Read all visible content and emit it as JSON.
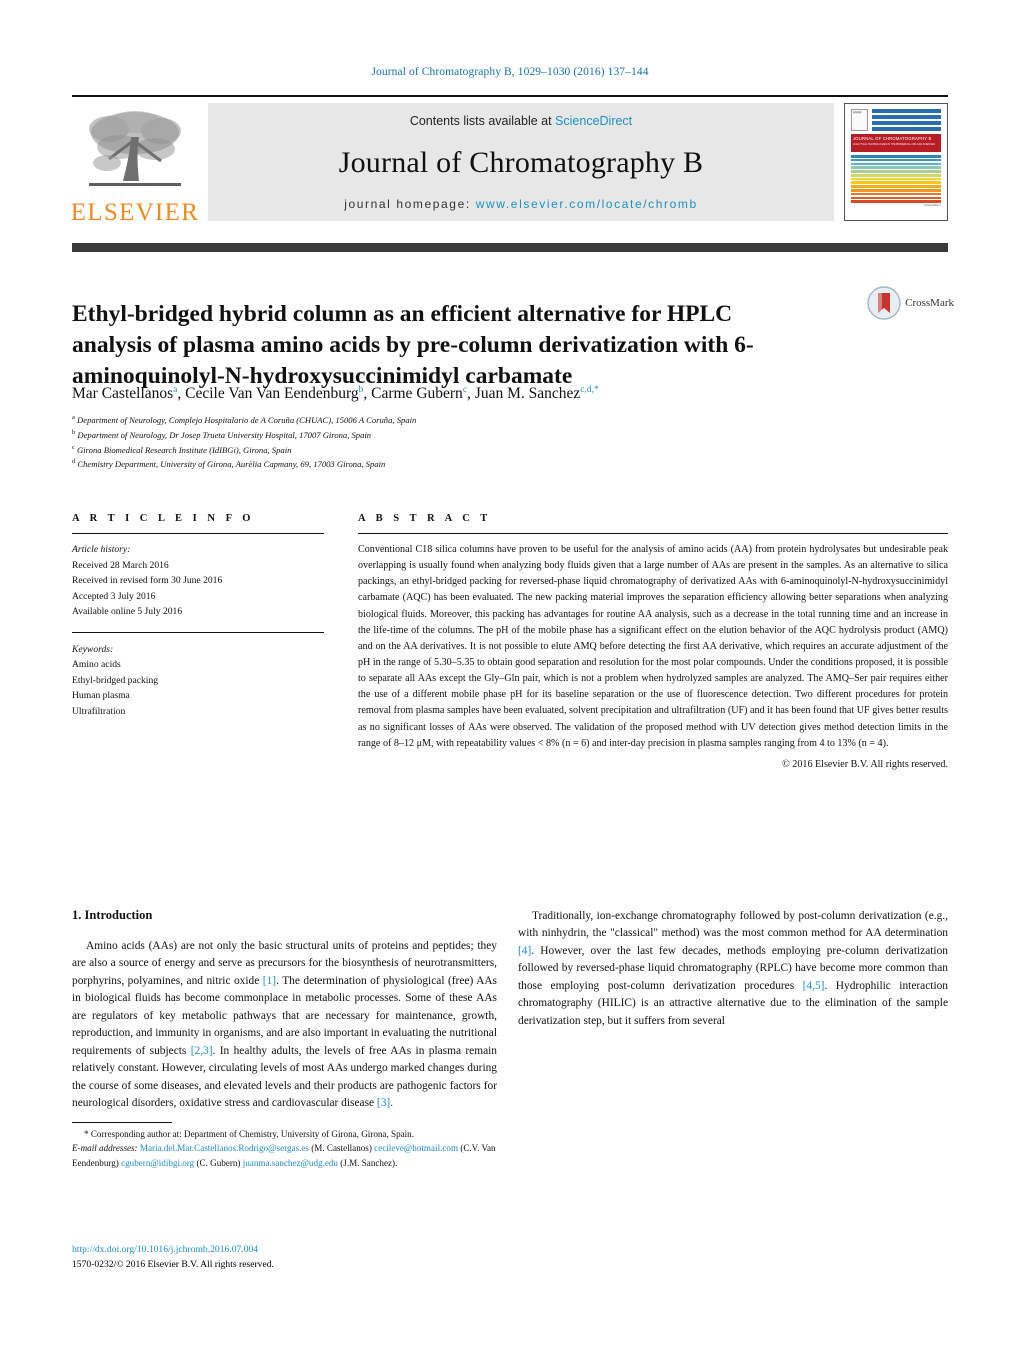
{
  "running_head": "Journal of Chromatography B, 1029–1030 (2016) 137–144",
  "masthead": {
    "contents_prefix": "Contents lists available at ",
    "contents_link": "ScienceDirect",
    "journal_title": "Journal of Chromatography B",
    "homepage_prefix": "journal homepage: ",
    "homepage_url": "www.elsevier.com/locate/chromb",
    "publisher": "ELSEVIER",
    "cover": {
      "banner_title": "JOURNAL OF CHROMATOGRAPHY B",
      "banner_subtitle": "ANALYTICAL TECHNOLOGIES IN THE BIOMEDICAL AND LIFE SCIENCES",
      "footer": "ScienceDirect"
    },
    "crossmark_label": "CrossMark"
  },
  "article": {
    "title": "Ethyl-bridged hybrid column as an efficient alternative for HPLC analysis of plasma amino acids by pre-column derivatization with 6-aminoquinolyl-N-hydroxysuccinimidyl carbamate",
    "authors": [
      {
        "name": "Mar Castellanos",
        "sup": "a"
      },
      {
        "name": "Cecile Van Van Eendenburg",
        "sup": "b"
      },
      {
        "name": "Carme Gubern",
        "sup": "c"
      },
      {
        "name": "Juan M. Sanchez",
        "sup": "c,d,*"
      }
    ],
    "affiliations": [
      {
        "marker": "a",
        "text": "Department of Neurology, Complejo Hospitalario de A Coruña (CHUAC), 15006 A Coruña, Spain"
      },
      {
        "marker": "b",
        "text": "Department of Neurology, Dr Josep Trueta University Hospital, 17007 Girona, Spain"
      },
      {
        "marker": "c",
        "text": "Girona Biomedical Research Institute (IdIBGi), Girona, Spain"
      },
      {
        "marker": "d",
        "text": "Chemistry Department, University of Girona, Aurèlia Capmany, 69, 17003 Girona, Spain"
      }
    ]
  },
  "article_info": {
    "heading": "A R T I C L E   I N F O",
    "history_label": "Article history:",
    "history": [
      "Received 28 March 2016",
      "Received in revised form 30 June 2016",
      "Accepted 3 July 2016",
      "Available online 5 July 2016"
    ],
    "keywords_label": "Keywords:",
    "keywords": [
      "Amino acids",
      "Ethyl-bridged packing",
      "Human plasma",
      "Ultrafiltration"
    ]
  },
  "abstract": {
    "heading": "A B S T R A C T",
    "text": "Conventional C18 silica columns have proven to be useful for the analysis of amino acids (AA) from protein hydrolysates but undesirable peak overlapping is usually found when analyzing body fluids given that a large number of AAs are present in the samples. As an alternative to silica packings, an ethyl-bridged packing for reversed-phase liquid chromatography of derivatized AAs with 6-aminoquinolyl-N-hydroxysuccinimidyl carbamate (AQC) has been evaluated. The new packing material improves the separation efficiency allowing better separations when analyzing biological fluids. Moreover, this packing has advantages for routine AA analysis, such as a decrease in the total running time and an increase in the life-time of the columns. The pH of the mobile phase has a significant effect on the elution behavior of the AQC hydrolysis product (AMQ) and on the AA derivatives. It is not possible to elute AMQ before detecting the first AA derivative, which requires an accurate adjustment of the pH in the range of 5.30–5.35 to obtain good separation and resolution for the most polar compounds. Under the conditions proposed, it is possible to separate all AAs except the Gly–Gln pair, which is not a problem when hydrolyzed samples are analyzed. The AMQ–Ser pair requires either the use of a different mobile phase pH for its baseline separation or the use of fluorescence detection. Two different procedures for protein removal from plasma samples have been evaluated, solvent precipitation and ultrafiltration (UF) and it has been found that UF gives better results as no significant losses of AAs were observed. The validation of the proposed method with UV detection gives method detection limits in the range of 8–12 μM, with repeatability values < 8% (n = 6) and inter-day precision in plasma samples ranging from 4 to 13% (n = 4).",
    "copyright": "© 2016 Elsevier B.V. All rights reserved."
  },
  "introduction": {
    "heading": "1.  Introduction",
    "para1_a": "Amino acids (AAs) are not only the basic structural units of proteins and peptides; they are also a source of energy and serve as precursors for the biosynthesis of neurotransmitters, porphyrins, polyamines, and nitric oxide ",
    "para1_ref1": "[1]",
    "para1_b": ". The determination of physiological (free) AAs in biological fluids has become commonplace in metabolic processes. Some of these AAs are regulators of key metabolic pathways that are necessary for maintenance, growth, reproduction, and immunity in organisms, and are also important in evaluating the nutritional requirements of subjects ",
    "para1_ref2": "[2,3]",
    "para1_c": ". In healthy adults, the levels of free AAs in plasma remain relatively constant. However, circulating levels of most AAs undergo marked changes during the course of some diseases, and elevated levels and their products are pathogenic factors for neurological disorders, oxidative stress and cardiovascular disease ",
    "para1_ref3": "[3]",
    "para1_d": ".",
    "para2_a": "Traditionally, ion-exchange chromatography followed by post-column derivatization (e.g., with ninhydrin, the \"classical\" method) was the most common method for AA determination ",
    "para2_ref1": "[4]",
    "para2_b": ". However, over the last few decades, methods employing pre-column derivatization followed by reversed-phase liquid chromatography (RPLC) have become more common than those employing post-column derivatization procedures ",
    "para2_ref2": "[4,5]",
    "para2_c": ". Hydrophilic interaction chromatography (HILIC) is an attractive alternative due to the elimination of the sample derivatization step, but it suffers from several"
  },
  "footnotes": {
    "corresponding": "* Corresponding author at: Department of Chemistry, University of Girona, Girona, Spain.",
    "email_label": "E-mail addresses:",
    "emails": [
      {
        "address": "Maria.del.Mar.Castellanos.Rodrigo@sergas.es",
        "owner": "(M. Castellanos)"
      },
      {
        "address": "cecileve@hotmail.com",
        "owner": "(C.V. Van Eendenburg)"
      },
      {
        "address": "cgubern@idibgi.org",
        "owner": "(C. Gubern)"
      },
      {
        "address": "juanma.sanchez@udg.edu",
        "owner": "(J.M. Sanchez)."
      }
    ],
    "doi": "http://dx.doi.org/10.1016/j.jchromb.2016.07.004",
    "issn_line": "1570-0232/© 2016 Elsevier B.V. All rights reserved."
  },
  "colors": {
    "link": "#1d8fc4",
    "elsevier_orange": "#f08b20",
    "cover_red": "#b81c25"
  }
}
